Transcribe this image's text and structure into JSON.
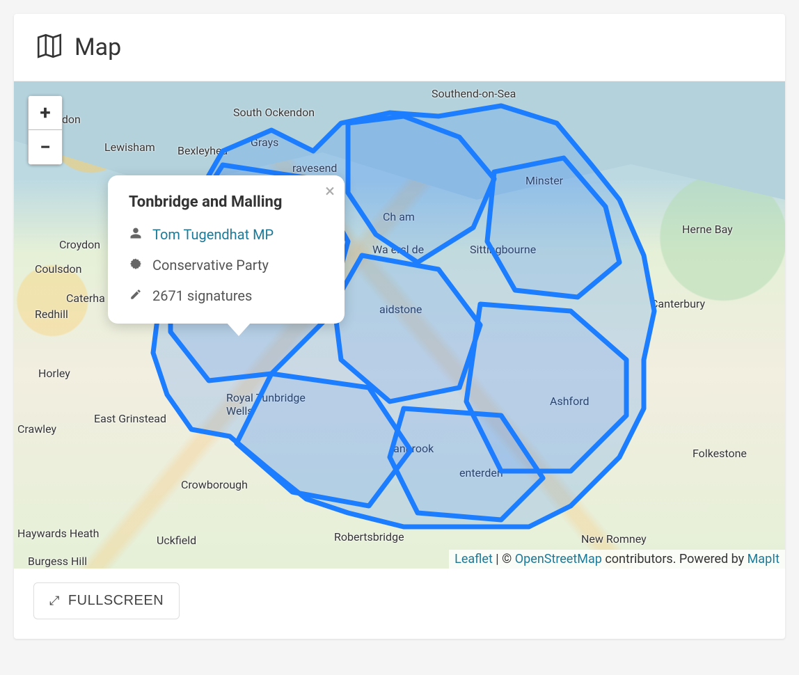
{
  "header": {
    "title": "Map"
  },
  "zoom": {
    "in": "+",
    "out": "−"
  },
  "popup": {
    "title": "Tonbridge and Malling",
    "mp": "Tom Tugendhat MP",
    "party": "Conservative Party",
    "signatures": "2671 signatures"
  },
  "places": {
    "southend": "Southend-on-Sea",
    "south_ockendon": "South Ockendon",
    "london": "ndon",
    "grays": "Grays",
    "lewisham": "Lewisham",
    "bexleyheath": "Bexleyhea",
    "gravesend": "ravesend",
    "croydon": "Croydon",
    "coulsdon": "Coulsdon",
    "caterham": "Caterha",
    "redhill": "Redhill",
    "horley": "Horley",
    "east_grinstead": "East Grinstead",
    "crawley": "Crawley",
    "crowborough": "Crowborough",
    "haywards": "Haywards Heath",
    "uckfield": "Uckfield",
    "burgess": "Burgess Hill",
    "royal_tunbridge": "Royal Tunbridge\nWells",
    "cranbrook": "ranbrook",
    "robertsbridge": "Robertsbridge",
    "tenterden": "enterden",
    "chatham": "Ch          am",
    "walderslade": "Wa   ersl  de",
    "maidstone": "aidstone",
    "sittingbourne": "Sittingbourne",
    "minster": "Minster",
    "herne_bay": "Herne Bay",
    "canterbury": "Canterbury",
    "ashford": "Ashford",
    "folkestone": "Folkestone",
    "new_romney": "New Romney"
  },
  "attribution": {
    "leaflet": "Leaflet",
    "sep": " | © ",
    "osm": "OpenStreetMap",
    "contrib": " contributors. Powered by ",
    "mapit": "MapIt"
  },
  "footer": {
    "fullscreen": "FULLSCREEN"
  }
}
